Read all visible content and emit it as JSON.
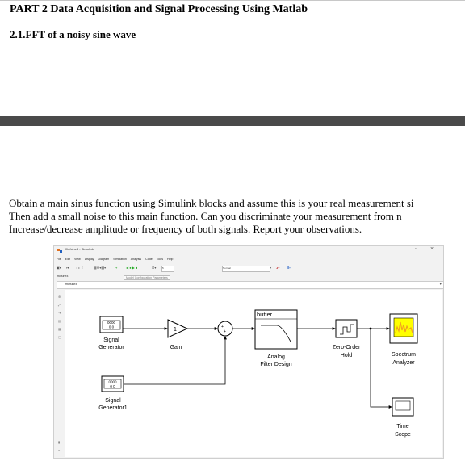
{
  "document": {
    "part_heading": "PART 2 Data Acquisition and Signal Processing Using Matlab",
    "section_heading": "2.1.FFT of a noisy sine wave",
    "paragraph_lines": [
      "Obtain a main sinus function using Simulink blocks and assume this is your real measurement si",
      "Then add a small noise to this main function. Can you discriminate your measurement from n",
      "Increase/decrease amplitude or frequency of both signals. Report your observations."
    ]
  },
  "simulink_window": {
    "title": "fftofsine4 - Simulink",
    "controls": {
      "minimize": "–",
      "maximize": "▫",
      "close": "×"
    },
    "menu": [
      "File",
      "Edit",
      "View",
      "Display",
      "Diagram",
      "Simulation",
      "Analysis",
      "Code",
      "Tools",
      "Help"
    ],
    "toolbar": {
      "stop_time": "5",
      "sim_mode": "Normal"
    },
    "model_name": "fftofsine4",
    "breadcrumb": "fftofsine4",
    "model_config_label": "Model Configuration Parameters",
    "blocks": {
      "signal_gen_1": {
        "display": "0000\n00",
        "label_line1": "Signal",
        "label_line2": "Generator"
      },
      "gain": {
        "value": "1",
        "label": "Gain"
      },
      "sum": {
        "signs": "+\n+"
      },
      "butter": {
        "header": "butter",
        "label_line1": "Analog",
        "label_line2": "Filter Design"
      },
      "zoh": {
        "label_line1": "Zero-Order",
        "label_line2": "Hold"
      },
      "spectrum": {
        "label_line1": "Spectrum",
        "label_line2": "Analyzer"
      },
      "signal_gen_2": {
        "display": "0000\n00",
        "label_line1": "Signal",
        "label_line2": "Generator1"
      },
      "scope": {
        "label_line1": "Time",
        "label_line2": "Scope"
      }
    }
  },
  "colors": {
    "separator": "#4a4a4a",
    "spectrum_screen": "#ffff00",
    "spectrum_signal": "#f0a020",
    "line": "#000000"
  }
}
